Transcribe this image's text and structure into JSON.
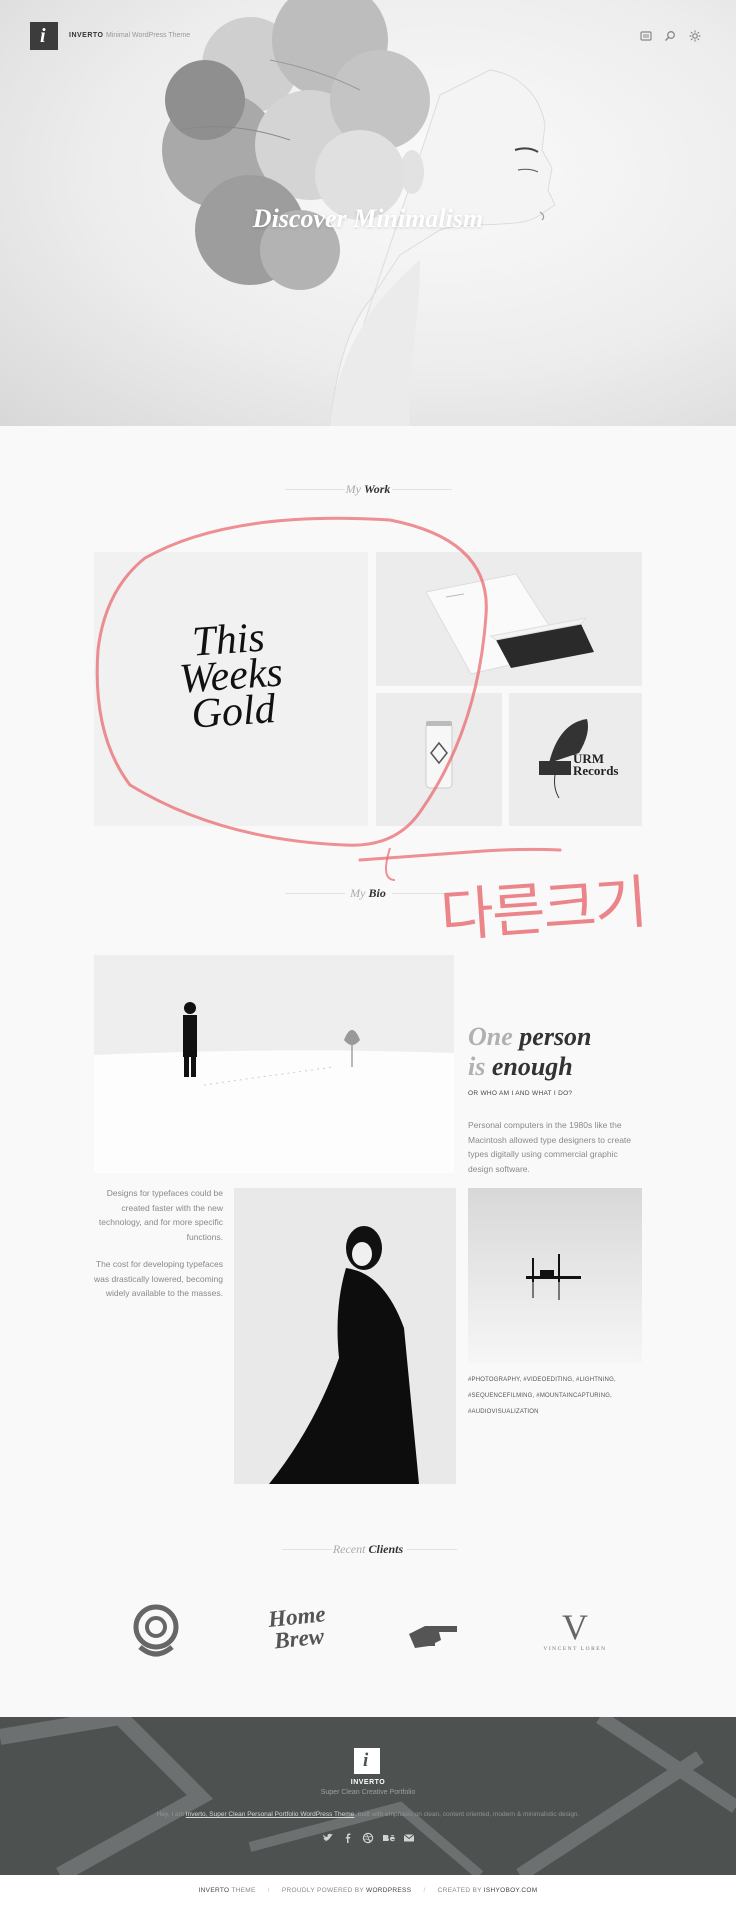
{
  "header": {
    "logo_letter": "i",
    "brand": "INVERTO",
    "tagline": "Minimal WordPress Theme",
    "icons": [
      "menu-icon",
      "search-icon",
      "settings-icon"
    ]
  },
  "hero": {
    "title": "Discover Minimalism"
  },
  "work": {
    "heading_light": "My",
    "heading_dark": "Work",
    "tiles": [
      {
        "name": "this-weeks-gold",
        "text_lines": [
          "This",
          "Weeks",
          "Gold"
        ]
      },
      {
        "name": "stationery",
        "text": ""
      },
      {
        "name": "can",
        "text": ""
      },
      {
        "name": "urm-records",
        "text_lines": [
          "URM",
          "Records"
        ]
      }
    ]
  },
  "annotation": {
    "korean_text": "다른크기"
  },
  "bio": {
    "heading_light": "My",
    "heading_dark": "Bio",
    "title_line1_light": "One",
    "title_line1_dark": "person",
    "title_line2_light": "is",
    "title_line2_dark": "enough",
    "subtitle": "OR WHO AM I AND WHAT I DO?",
    "text": "Personal computers in the 1980s like the Macintosh allowed type designers to create types digitally using commercial graphic design software.",
    "left_text_1": "Designs for typefaces could be created faster with the new technology, and for more specific functions.",
    "left_text_2": "The cost for developing typefaces was drastically lowered, becoming widely available to the masses.",
    "tags_line1": "#PHOTOGRAPHY,   #VIDEOEDITING,   #LIGHTNING,",
    "tags_line2": "#SEQUENCEFILMING,   #MOUNTAINCAPTURING,",
    "tags_line3": "#AUDIOVISUALIZATION"
  },
  "clients": {
    "heading_light": "Recent",
    "heading_dark": "Clients",
    "logos": [
      {
        "name": "swirl-logo",
        "text": ""
      },
      {
        "name": "home-brew-logo",
        "text_lines": [
          "Home",
          "Brew"
        ]
      },
      {
        "name": "hand-logo",
        "text": ""
      },
      {
        "name": "vincent-loren-logo",
        "letter": "V",
        "text": "VINCENT LOREN"
      }
    ]
  },
  "footer": {
    "logo_letter": "i",
    "brand": "INVERTO",
    "tagline": "Super Clean Creative Portfolio",
    "desc_prefix": "Hey, I am",
    "desc_link": "Inverto, Super Clean Personal Portfolio WordPress Theme",
    "desc_suffix": ", built with emphasis on clean, content oriented, modern & minimalistic design.",
    "social_icons": [
      "twitter-icon",
      "facebook-icon",
      "dribbble-icon",
      "behance-icon",
      "mail-icon"
    ],
    "bottom": {
      "theme_label": "INVERTO",
      "theme_suffix": "THEME",
      "powered_label": "PROUDLY POWERED BY",
      "powered_name": "WORDPRESS",
      "created_label": "CREATED BY",
      "created_name": "ISHYOBOY.COM"
    }
  },
  "colors": {
    "accent_annotation": "#e8656b",
    "footer_bg": "#4d5150",
    "text_dark": "#333333",
    "text_light": "#aaaaaa"
  }
}
